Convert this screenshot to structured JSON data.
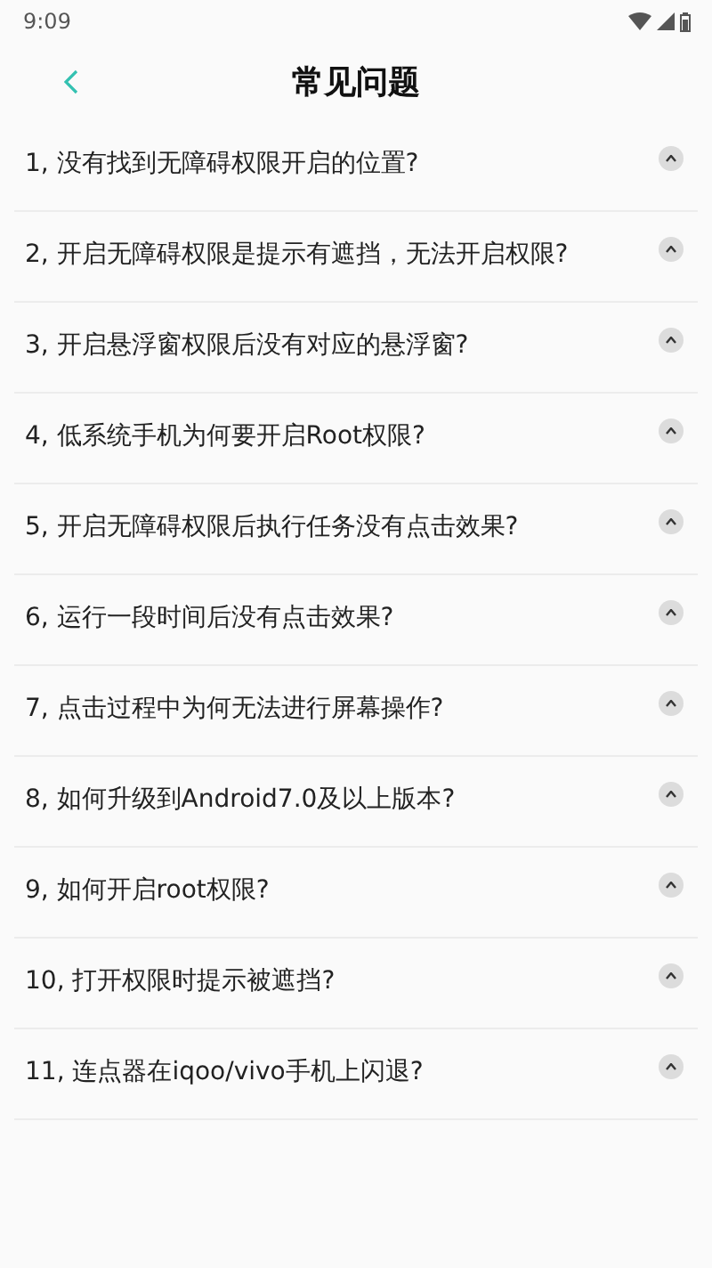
{
  "status_bar": {
    "time": "9:09"
  },
  "header": {
    "title": "常见问题"
  },
  "questions": [
    {
      "text": "1, 没有找到无障碍权限开启的位置?",
      "expanded": false
    },
    {
      "text": "2, 开启无障碍权限是提示有遮挡，无法开启权限?",
      "expanded": false
    },
    {
      "text": "3, 开启悬浮窗权限后没有对应的悬浮窗?",
      "expanded": false
    },
    {
      "text": "4, 低系统手机为何要开启Root权限?",
      "expanded": false
    },
    {
      "text": "5, 开启无障碍权限后执行任务没有点击效果?",
      "expanded": false
    },
    {
      "text": "6, 运行一段时间后没有点击效果?",
      "expanded": false
    },
    {
      "text": "7, 点击过程中为何无法进行屏幕操作?",
      "expanded": false
    },
    {
      "text": "8, 如何升级到Android7.0及以上版本?",
      "expanded": false
    },
    {
      "text": "9, 如何开启root权限?",
      "expanded": false
    },
    {
      "text": "10, 打开权限时提示被遮挡?",
      "expanded": false
    },
    {
      "text": "11, 连点器在iqoo/vivo手机上闪退?",
      "expanded": false
    }
  ]
}
